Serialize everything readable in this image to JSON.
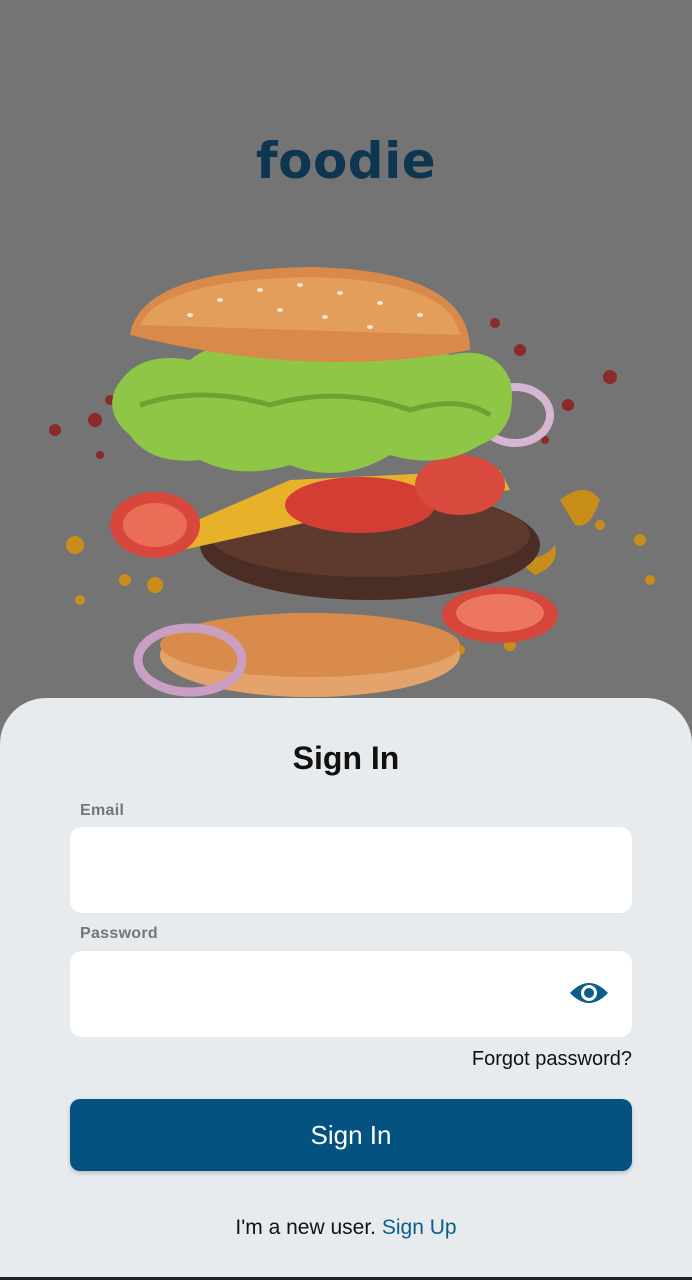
{
  "brand": {
    "name": "foodie"
  },
  "hero": {
    "image_subject": "burger-illustration"
  },
  "sign_in": {
    "title": "Sign In",
    "email_label": "Email",
    "email_value": "",
    "password_label": "Password",
    "password_value": "",
    "forgot_label": "Forgot password?",
    "submit_label": "Sign In",
    "new_user_text": "I'm a new user.",
    "signup_label": "Sign Up"
  },
  "colors": {
    "brand_text": "#0e3650",
    "primary": "#045280",
    "link": "#0b5d8c",
    "sheet_bg": "#e7ebee",
    "overlay_bg": "#747474"
  },
  "icons": {
    "password_toggle": "eye-icon"
  }
}
